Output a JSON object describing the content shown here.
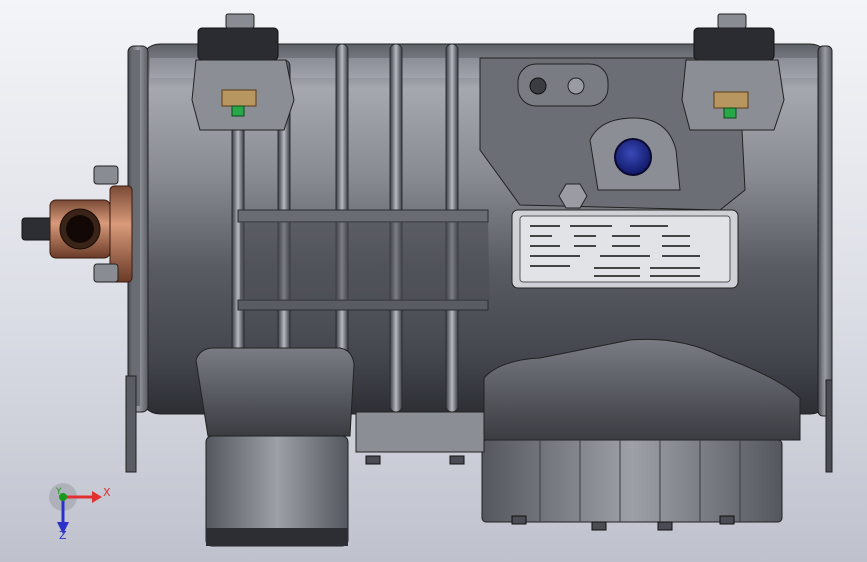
{
  "viewport": {
    "background_top": "#f4f5f8",
    "background_bottom": "#bfc2cd"
  },
  "model": {
    "body_color": "#8a8c94",
    "port_color": "#1c2a8c",
    "fitting_color": "#c87a5a",
    "nut_color": "#b89660",
    "seal_color": "#28a848"
  },
  "triad": {
    "x_label": "X",
    "y_label": "Y",
    "z_label": "Z",
    "x_color": "#e03030",
    "y_color": "#1a9a1a",
    "z_color": "#2a30c8"
  }
}
